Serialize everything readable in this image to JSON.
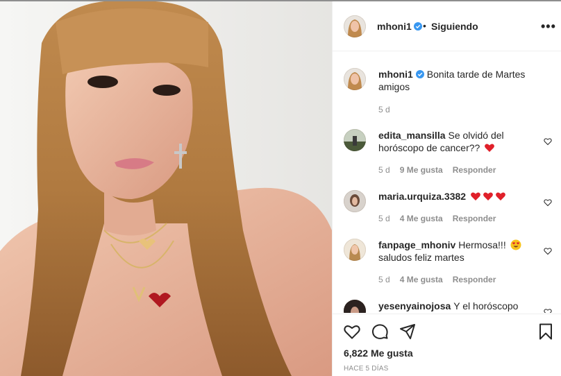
{
  "header": {
    "username": "mhoni1",
    "separator": "•",
    "follow_status": "Siguiendo",
    "more_label": "•••"
  },
  "caption": {
    "username": "mhoni1",
    "text": "Bonita tarde de Martes amigos",
    "time": "5 d"
  },
  "comments": [
    {
      "username": "edita_mansilla",
      "text": "Se olvidó del horóscopo de cancer??",
      "emojis": [
        "red-heart"
      ],
      "time": "5 d",
      "likes": "9 Me gusta",
      "reply": "Responder"
    },
    {
      "username": "maria.urquiza.3382",
      "text": "",
      "emojis": [
        "red-heart",
        "red-heart",
        "red-heart"
      ],
      "time": "5 d",
      "likes": "4 Me gusta",
      "reply": "Responder"
    },
    {
      "username": "fanpage_mhoniv",
      "text": "Hermosa!!!",
      "text2": "saludos feliz martes",
      "emojis": [
        "heart-eyes"
      ],
      "time": "5 d",
      "likes": "4 Me gusta",
      "reply": "Responder"
    },
    {
      "username": "yesenyainojosa",
      "text": "Y el horóscopo"
    }
  ],
  "footer": {
    "likes_count": "6,822",
    "likes_label": "Me gusta",
    "time_ago": "HACE 5 DÍAS"
  },
  "icons": [
    "heart-outline-icon",
    "comment-icon",
    "share-icon",
    "bookmark-icon",
    "verified-badge-icon",
    "more-options-icon"
  ],
  "colors": {
    "verified": "#3897f0",
    "heart": "#ed4956",
    "muted": "#8e8e8e",
    "text": "#262626"
  }
}
